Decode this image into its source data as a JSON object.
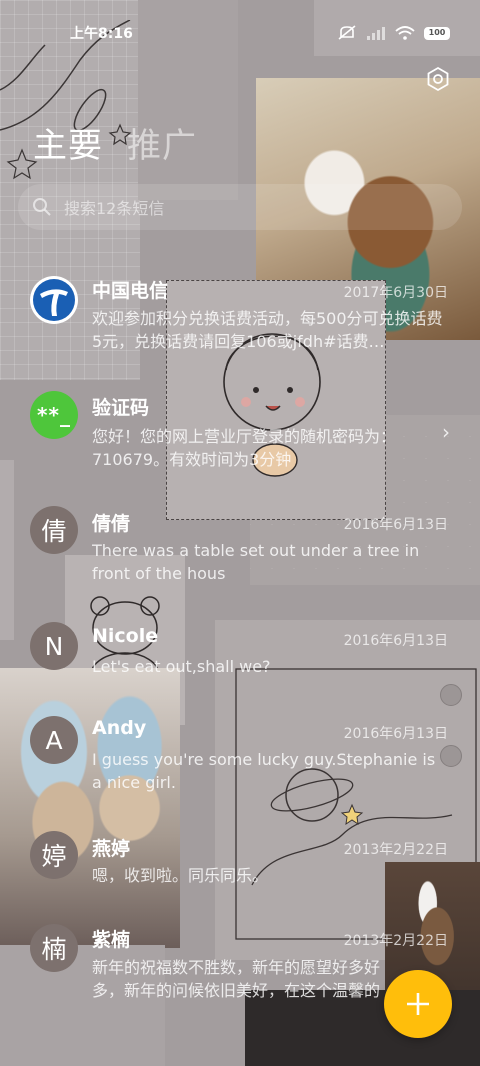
{
  "status_bar": {
    "time": "上午8:16",
    "battery": "100",
    "icons": [
      "mute-icon",
      "signal-icon",
      "wifi-icon",
      "battery-icon"
    ]
  },
  "header": {
    "tabs": [
      {
        "label": "主要",
        "active": true
      },
      {
        "label": "推广",
        "active": false
      }
    ],
    "settings_icon": "settings-icon"
  },
  "search": {
    "placeholder": "搜索12条短信",
    "icon": "search-icon"
  },
  "conversations": [
    {
      "sender": "中国电信",
      "date": "2017年6月30日",
      "preview": "欢迎参加积分兑换话费活动，每500分可兑换话费5元，兑换话费请回复106或jfdh#话费…",
      "avatar": "telecom-logo"
    },
    {
      "sender": "验证码",
      "date": "",
      "preview": "您好！您的网上营业厅登录的随机密码为：710679。有效时间为3分钟",
      "avatar": "**_"
    },
    {
      "sender": "倩倩",
      "date": "2016年6月13日",
      "preview": "There was a table set out under a tree in front of the hous",
      "avatar": "倩"
    },
    {
      "sender": "Nicole",
      "date": "2016年6月13日",
      "preview": "Let's eat out,shall we?",
      "avatar": "N"
    },
    {
      "sender": "Andy",
      "date": "2016年6月13日",
      "preview": "I guess you're some lucky guy.Stephanie is a nice girl.",
      "avatar": "A"
    },
    {
      "sender": "燕婷",
      "date": "2013年2月22日",
      "preview": "嗯，收到啦。同乐同乐。",
      "avatar": "婷"
    },
    {
      "sender": "紫楠",
      "date": "2013年2月22日",
      "preview": "新年的祝福数不胜数，新年的愿望好多好多，新年的问候依旧美好，在这个温馨的时…",
      "avatar": "楠"
    }
  ],
  "colors": {
    "fab": "#ffbe0b",
    "verification_avatar": "#4ec63b",
    "telecom_blue": "#1a5fb4",
    "avatar_default": "#7d716e"
  },
  "fab": {
    "label": "+",
    "icon": "plus-icon"
  }
}
